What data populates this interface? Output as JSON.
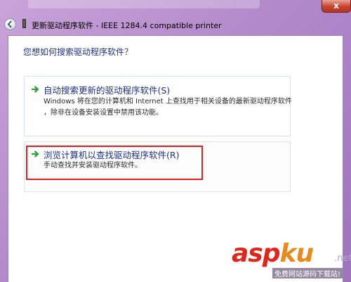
{
  "window": {
    "title": "更新驱动程序软件 - IEEE 1284.4 compatible printer",
    "close_label": "x"
  },
  "prompt": {
    "question": "您想如何搜索驱动程序软件？"
  },
  "options": [
    {
      "title": "自动搜索更新的驱动程序软件(S)",
      "description_line1": "Windows 将在您的计算机和 Internet 上查找用于相关设备的最新驱动程序软件",
      "description_line2": "，除非在设备安装设置中禁用该功能。"
    },
    {
      "title": "浏览计算机以查找驱动程序软件(R)",
      "description_line1": "手动查找并安装驱动程序软件。"
    }
  ],
  "watermark": {
    "brand_part1": "asp",
    "brand_part2": "ku",
    "suffix": ".net",
    "tagline": "免费网站源码下载站!"
  },
  "colors": {
    "link_blue": "#1e3287",
    "highlight_red": "#e0201c",
    "arrow_green": "#2e9e3a",
    "background_purple": "#b48ccc"
  },
  "icons": {
    "back": "back-arrow-icon",
    "device": "printer-device-icon",
    "option_arrow": "green-arrow-icon"
  }
}
